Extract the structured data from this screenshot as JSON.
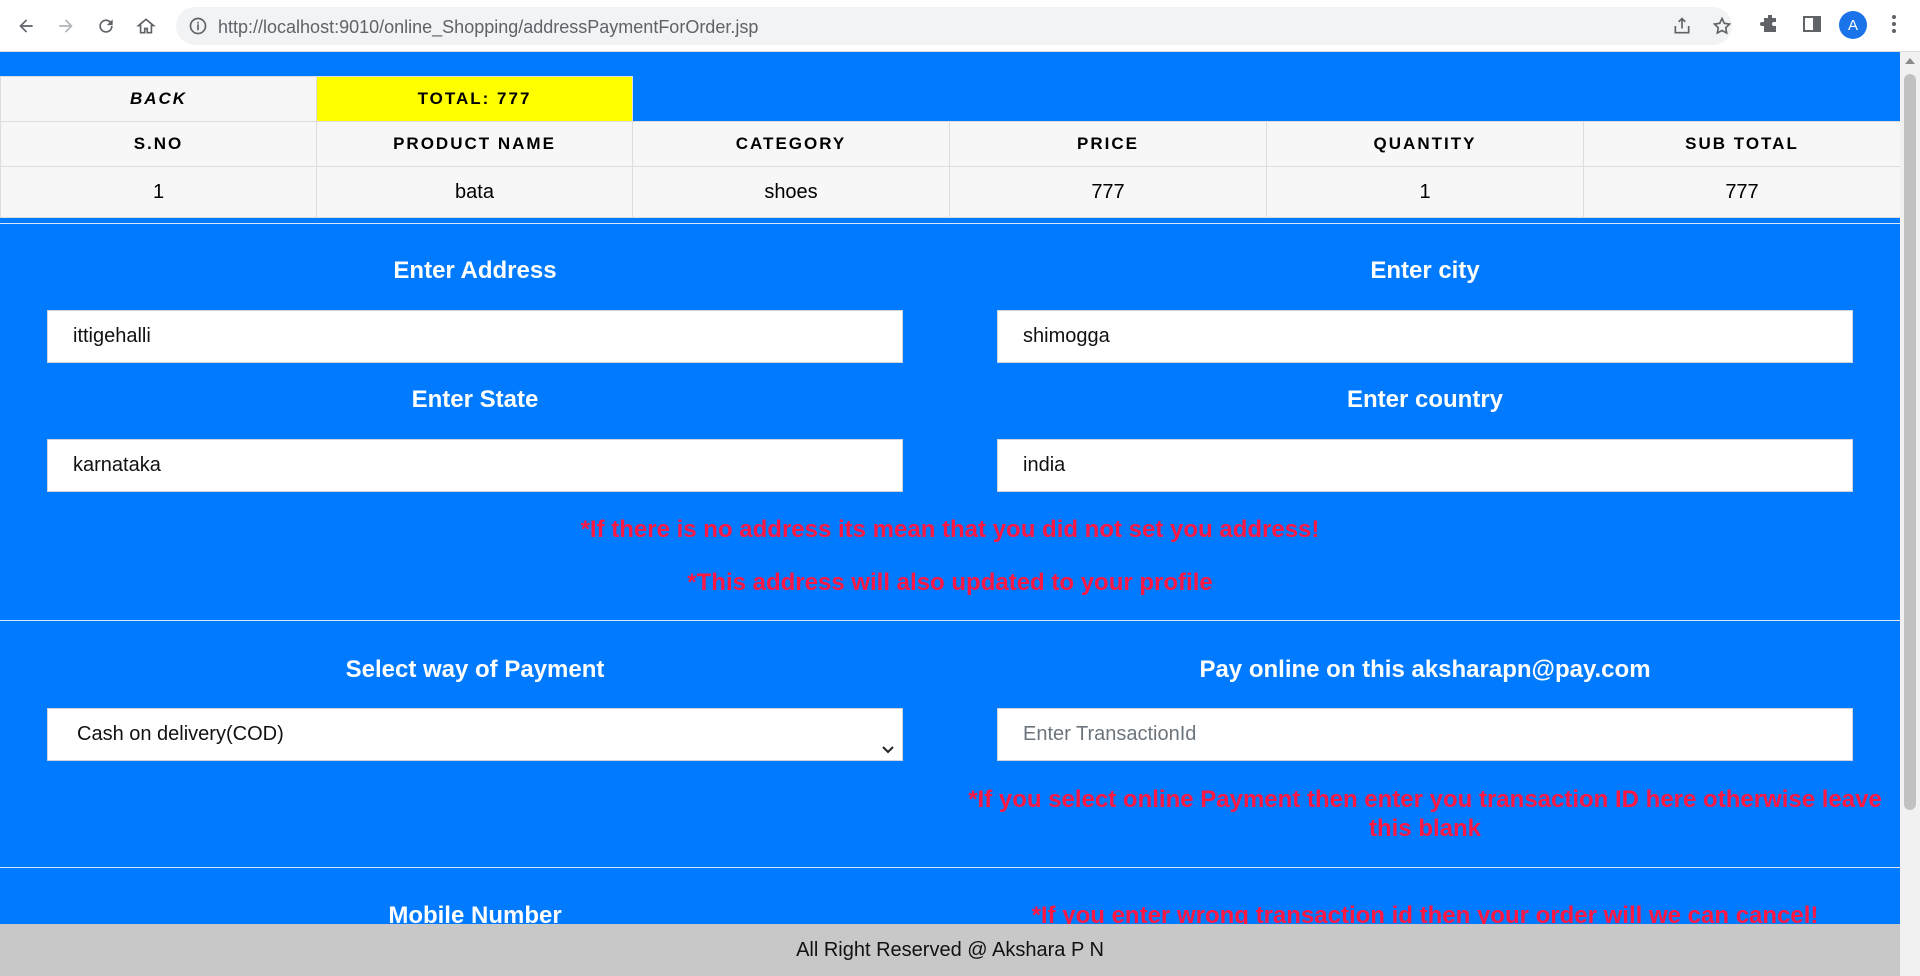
{
  "browser": {
    "url_host": "http://localhost",
    "url_path": ":9010/online_Shopping/addressPaymentForOrder.jsp",
    "avatar_letter": "A"
  },
  "order": {
    "back_label": "BACK",
    "total_label": "TOTAL: 777",
    "columns": [
      "S.NO",
      "PRODUCT NAME",
      "CATEGORY",
      "PRICE",
      "QUANTITY",
      "SUB TOTAL"
    ],
    "rows": [
      [
        "1",
        "bata",
        "shoes",
        "777",
        "1",
        "777"
      ]
    ]
  },
  "address": {
    "address_label": "Enter Address",
    "address_value": "ittigehalli",
    "city_label": "Enter city",
    "city_value": "shimogga",
    "state_label": "Enter State",
    "state_value": "karnataka",
    "country_label": "Enter country",
    "country_value": "india",
    "warning_1": "*If there is no address its mean that you did not set you address!",
    "warning_2": "*This address will also updated to your profile"
  },
  "payment": {
    "select_label": "Select way of Payment",
    "select_value": "Cash on delivery(COD)",
    "online_label": "Pay online on this aksharapn@pay.com",
    "transaction_placeholder": "Enter TransactionId",
    "transaction_warning": "*If you select online Payment then enter you transaction ID here otherwise leave this blank"
  },
  "mobile": {
    "label": "Mobile Number",
    "warning": "*If you enter wrong transaction id then your order will we can cancel!"
  },
  "footer": {
    "text": "All Right Reserved @ Akshara P N"
  },
  "colors": {
    "page_bg": "#007bff",
    "total_highlight": "#ffff00",
    "warning": "#ff1744",
    "footer_bg": "#c8c8c8"
  }
}
